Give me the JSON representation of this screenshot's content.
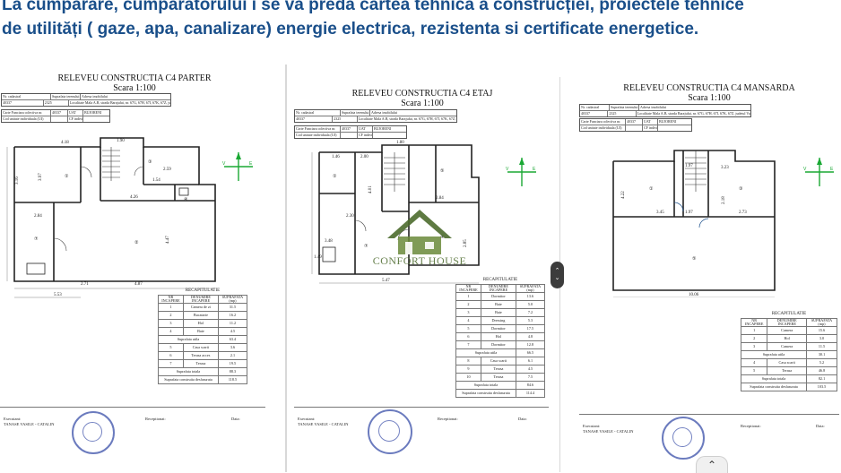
{
  "heading": {
    "line1": "La cumpărare, cumpăratorului i se va preda cartea tehnica a construcției, proiectele tehnice",
    "line2": "de utilități ( gaze, apa, canalizare) energie electrica, rezistenta si certificate energetice."
  },
  "colors": {
    "heading": "#1a4f8a",
    "stamp": "#3a4fa8",
    "compass": "#1aa834",
    "watermark": "#4d6b2e"
  },
  "sheets": [
    {
      "title": "RELEVEU CONSTRUCTIA C4 PARTER",
      "scale": "Scara 1:100",
      "header": {
        "r1": [
          "Nr. cadastral",
          "Suprafata terenului (mp)",
          "Adresa imobilului"
        ],
        "r2": [
          "40337",
          "2325",
          "Localitate Mala A.B, strada Barajului, nr. 67G, 67H, 67I, 67K, 67Z, judetul Valcea"
        ],
        "r3": [
          "Carte Funciara colectiva nr.",
          "40337",
          "UAT",
          "BUJORENI"
        ],
        "r4": [
          "Cod unitate individuala (UI)",
          "",
          "CF individuala",
          ""
        ]
      },
      "recap": {
        "title": "RECAPITULATIE",
        "cols": [
          "NR INCAPERE",
          "DENUMIRE INCAPERE",
          "SUPRAFATA (mp)"
        ],
        "rows": [
          [
            "1",
            "Camera de zi",
            "31.5"
          ],
          [
            "2",
            "Bucatarie",
            "16.2"
          ],
          [
            "3",
            "Hol",
            "11.2"
          ],
          [
            "4",
            "Baie",
            "4.5"
          ]
        ],
        "util": [
          "Suprafata utila",
          "63.4"
        ],
        "rows2": [
          [
            "5",
            "Casa scarii",
            "3.6"
          ],
          [
            "6",
            "Terasa acces",
            "2.1"
          ],
          [
            "7",
            "Terasa",
            "19.5"
          ]
        ],
        "total": [
          "Suprafata totala",
          "88.3"
        ],
        "built": [
          "Suprafata construita desfasurata",
          "118.5"
        ]
      },
      "sig": {
        "left1": "Executant:",
        "left2": "TANASE VASILE - CATALIN",
        "mid": "Receptionat:",
        "right": "Data:"
      }
    },
    {
      "title": "RELEVEU CONSTRUCTIA C4 ETAJ",
      "scale": "Scara 1:100",
      "header": {
        "r1": [
          "Nr. cadastral",
          "Suprafata terenului (mp)",
          "Adresa imobilului"
        ],
        "r2": [
          "40337",
          "2325",
          "Localitate Mala A.B, strada Barajului, nr. 67G, 67H, 67I, 67K, 67Z, judetul Valcea"
        ],
        "r3": [
          "Carte Funciara colectiva nr.",
          "40337",
          "UAT",
          "BUJORENI"
        ],
        "r4": [
          "Cod unitate individuala (UI)",
          "",
          "CF individuala",
          ""
        ]
      },
      "recap": {
        "title": "RECAPITULATIE",
        "cols": [
          "NR INCAPERE",
          "DENUMIRE INCAPERE",
          "SUPRAFATA (mp)"
        ],
        "rows": [
          [
            "1",
            "Dormitor",
            "13.6"
          ],
          [
            "2",
            "Baie",
            "5.0"
          ],
          [
            "3",
            "Baie",
            "7.2"
          ],
          [
            "4",
            "Dressing",
            "5.3"
          ],
          [
            "5",
            "Dormitor",
            "17.5"
          ],
          [
            "6",
            "Hol",
            "4.8"
          ],
          [
            "7",
            "Dormitor",
            "12.8"
          ]
        ],
        "util": [
          "Suprafata utila",
          "66.5"
        ],
        "rows2": [
          [
            "8",
            "Casa scarii",
            "6.1"
          ],
          [
            "9",
            "Terasa",
            "4.5"
          ],
          [
            "10",
            "Terasa",
            "7.5"
          ]
        ],
        "total": [
          "Suprafata totala",
          "84.6"
        ],
        "built": [
          "Suprafata construita desfasurata",
          "114.4"
        ]
      },
      "sig": {
        "left1": "Executant:",
        "left2": "TANASE VASILE - CATALIN",
        "mid": "Receptionat:",
        "right": "Data:"
      }
    },
    {
      "title": "RELEVEU CONSTRUCTIA C4 MANSARDA",
      "scale": "Scara 1:100",
      "header": {
        "r1": [
          "Nr. cadastral",
          "Suprafata terenului (mp)",
          "Adresa imobilului"
        ],
        "r2": [
          "40337",
          "2325",
          "Localitate Mala A.B, strada Barajului, nr. 67G, 67H, 67I, 67K, 67Z, judetul Valcea"
        ],
        "r3": [
          "Carte Funciara colectiva nr.",
          "40337",
          "UAT",
          "BUJORENI"
        ],
        "r4": [
          "Cod unitate individuala (UI)",
          "",
          "CF individuala",
          ""
        ]
      },
      "recap": {
        "title": "RECAPITULATIE",
        "cols": [
          "NR INCAPERE",
          "DENUMIRE INCAPERE",
          "SUPRAFATA (mp)"
        ],
        "rows": [
          [
            "1",
            "Camera",
            "15.6"
          ],
          [
            "2",
            "Hol",
            "3.0"
          ],
          [
            "3",
            "Camera",
            "11.5"
          ]
        ],
        "util": [
          "Suprafata utila",
          "30.1"
        ],
        "rows2": [
          [
            "4",
            "Casa scarii",
            "5.2"
          ],
          [
            "5",
            "Terasa",
            "46.8"
          ]
        ],
        "total": [
          "Suprafata totala",
          "82.1"
        ],
        "built": [
          "Suprafata construita desfasurata",
          "103.5"
        ]
      },
      "sig": {
        "left1": "Executant:",
        "left2": "TANASE VASILE - CATALIN",
        "mid": "Receptionat:",
        "right": "Data:"
      }
    }
  ],
  "dims": {
    "p": [
      "4.18",
      "3.97",
      "1.90",
      "2.59",
      "4.26",
      "2.84",
      "2.71",
      "4.87",
      "5.53",
      "4.47",
      "1.54",
      "3.16"
    ],
    "e": [
      "1.46",
      "2.00",
      "2.84",
      "5.47",
      "1.80",
      "3.48",
      "4.01",
      "2.30",
      "1.49",
      "2.85"
    ],
    "m": [
      "1.97",
      "3.23",
      "4.22",
      "1.97",
      "2.73",
      "2.18",
      "3.45",
      "10.06"
    ]
  },
  "watermark": "CONFORT HOUSE",
  "scroll_nav": {
    "up": "⌃",
    "down": "⌄"
  },
  "collapse_icon": "⌃"
}
